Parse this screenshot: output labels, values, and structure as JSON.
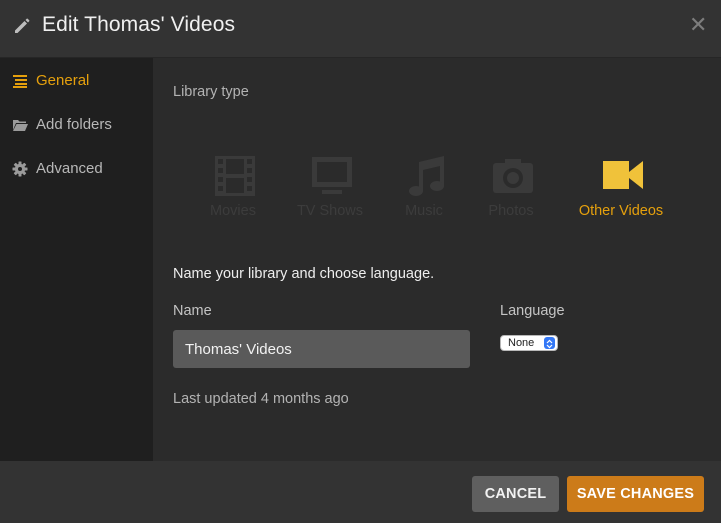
{
  "header": {
    "title": "Edit Thomas' Videos",
    "close_glyph": "✕"
  },
  "sidebar": {
    "items": [
      {
        "label": "General",
        "icon": "list-icon",
        "active": true
      },
      {
        "label": "Add folders",
        "icon": "folder-icon",
        "active": false
      },
      {
        "label": "Advanced",
        "icon": "gear-icon",
        "active": false
      }
    ]
  },
  "main": {
    "library_type_label": "Library type",
    "types": [
      {
        "label": "Movies",
        "icon": "film-icon",
        "selected": false
      },
      {
        "label": "TV Shows",
        "icon": "tv-icon",
        "selected": false
      },
      {
        "label": "Music",
        "icon": "music-note-icon",
        "selected": false
      },
      {
        "label": "Photos",
        "icon": "camera-icon",
        "selected": false
      },
      {
        "label": "Other Videos",
        "icon": "video-camera-icon",
        "selected": true
      }
    ],
    "prompt": "Name your library and choose language.",
    "name_label": "Name",
    "name_value": "Thomas' Videos",
    "language_label": "Language",
    "language_value": "None",
    "last_updated": "Last updated 4 months ago"
  },
  "footer": {
    "cancel_label": "CANCEL",
    "save_label": "SAVE CHANGES"
  },
  "colors": {
    "accent": "#e5a00d",
    "save_button": "#cc7b19",
    "cancel_button": "#5f5f5f"
  }
}
